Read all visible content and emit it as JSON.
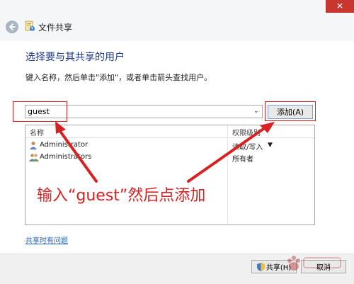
{
  "window": {
    "title": "文件共享",
    "close_label": "✕"
  },
  "main": {
    "heading": "选择要与其共享的用户",
    "instruction": "键入名称，然后单击\"添加\"，或者单击箭头查找用户。",
    "name_input": {
      "value": "guest",
      "placeholder": ""
    },
    "add_button": "添加(A)"
  },
  "table": {
    "headers": [
      "名称",
      "权限级别"
    ],
    "rows": [
      {
        "name": "Administrator",
        "permission": "读取/写入"
      },
      {
        "name": "Administrators",
        "permission": "所有者"
      }
    ]
  },
  "annotation": {
    "text": "输入“guest”然后点添加",
    "color": "#d62222"
  },
  "footer": {
    "help_link": "共享时有问题",
    "share_button": "共享(H)",
    "cancel_button": "取消"
  },
  "colors": {
    "accent": "#1e3c8c",
    "link": "#1f5fbf",
    "annotation_red": "#d62222"
  },
  "icons": [
    "back-arrow-icon",
    "file-share-icon",
    "user-icon",
    "group-icon",
    "shield-icon",
    "chevron-down-icon"
  ]
}
